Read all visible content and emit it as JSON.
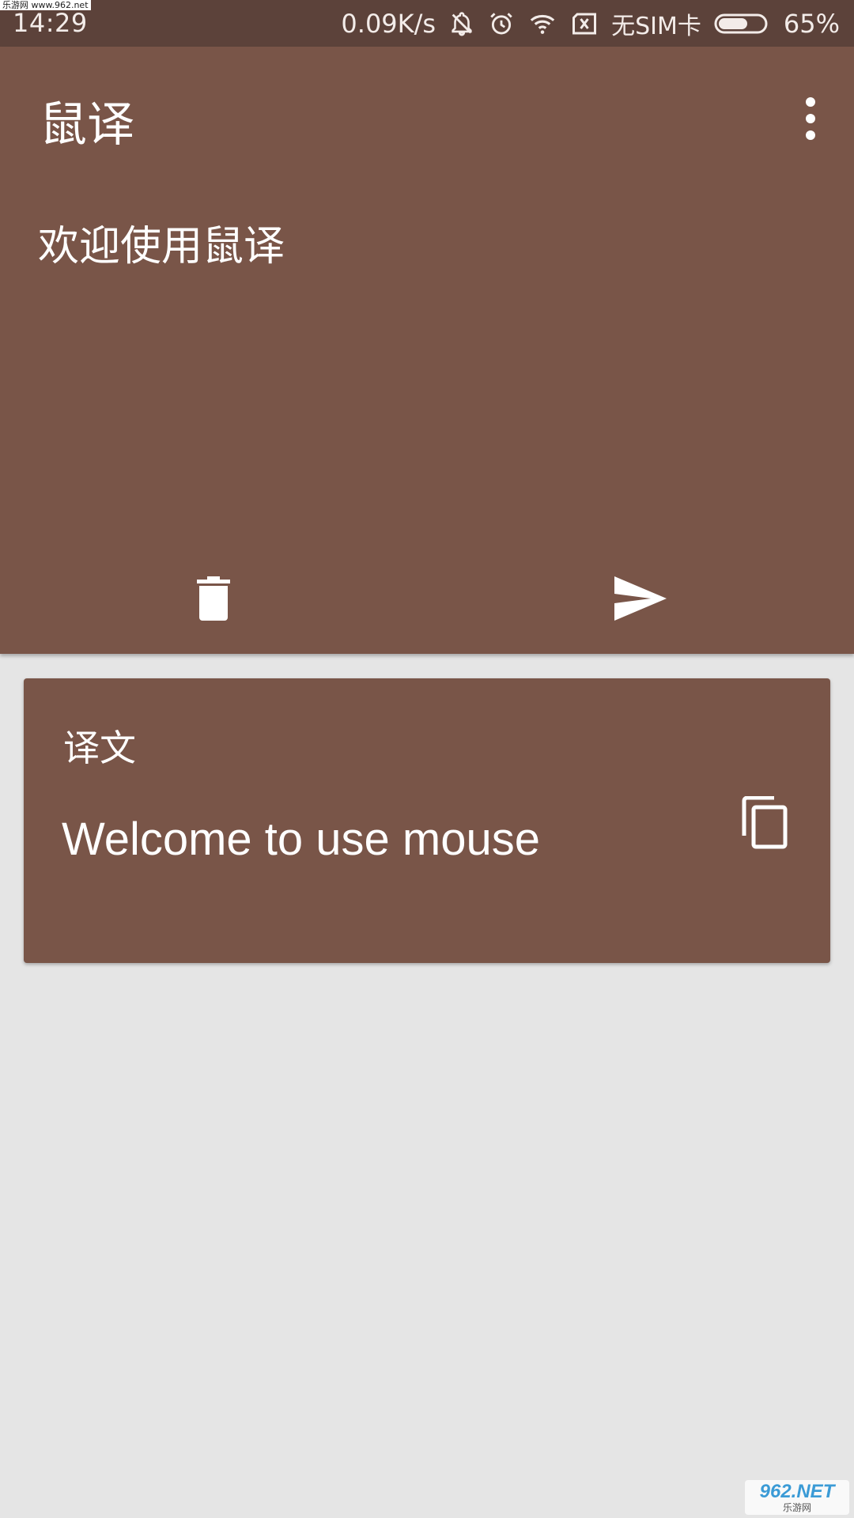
{
  "status_bar": {
    "watermark": "乐游网 www.962.net",
    "time": "14:29",
    "net_speed": "0.09K/s",
    "sim_status": "无SIM卡",
    "battery_percent": "65%",
    "battery_level": 0.65,
    "icons": [
      "notifications-off-icon",
      "alarm-icon",
      "wifi-icon",
      "no-sim-icon",
      "battery-icon"
    ]
  },
  "app_bar": {
    "title": "鼠译",
    "overflow_icon": "more-vertical-icon"
  },
  "source": {
    "text": "欢迎使用鼠译"
  },
  "actions": {
    "delete_icon": "delete-icon",
    "send_icon": "send-icon"
  },
  "result": {
    "label": "译文",
    "text": "Welcome to use mouse",
    "copy_icon": "copy-icon"
  },
  "watermark_bottom": {
    "logo": "962.NET",
    "sub": "乐游网"
  },
  "colors": {
    "primary": "#795548",
    "status_bar": "#5c423a",
    "background": "#e5e5e5",
    "on_primary": "#ffffff"
  }
}
